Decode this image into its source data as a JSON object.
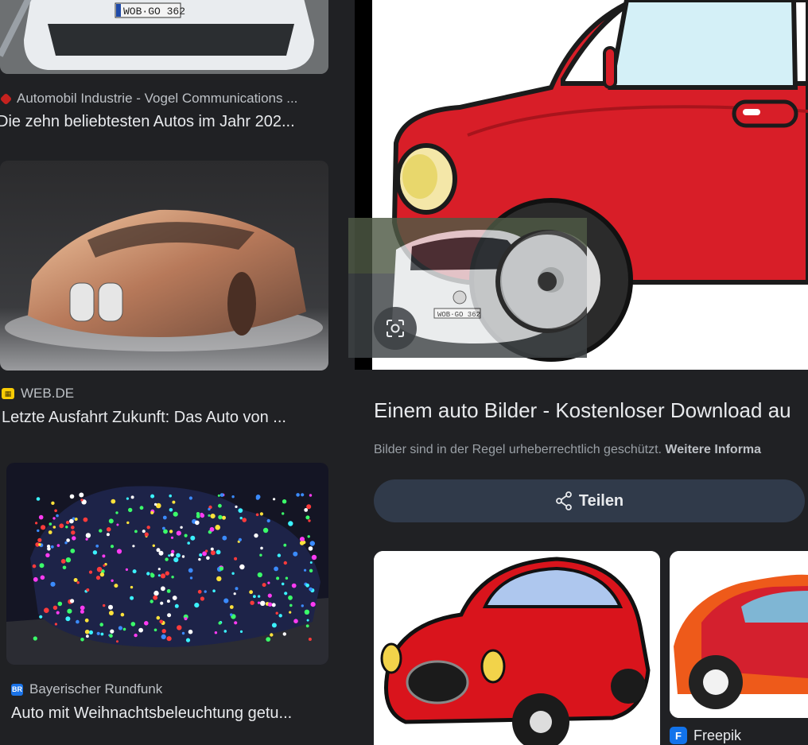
{
  "results": [
    {
      "source": "Automobil Industrie - Vogel Communications ...",
      "title": "Die zehn beliebtesten Autos im Jahr 202...",
      "plate": "WOB·GO 362"
    },
    {
      "source": "WEB.DE",
      "title": "Letzte Ausfahrt Zukunft: Das Auto von ..."
    },
    {
      "source": "Bayerischer Rundfunk",
      "title": "Auto mit Weihnachtsbeleuchtung getu...",
      "favicon_text": "BR"
    }
  ],
  "preview": {
    "title": "Einem auto Bilder - Kostenloser Download au",
    "notice": "Bilder sind in der Regel urheberrechtlich geschützt.",
    "notice_link": "Weitere Informa",
    "share_label": "Teilen",
    "overlay_plate": "WOB·GO 362",
    "related_source": "Freepik"
  },
  "colors": {
    "background": "#202124",
    "panel": "#202124",
    "share_button": "#303a4a",
    "car_red": "#d81e28"
  },
  "icons": [
    "lens-icon",
    "share-icon",
    "freepik-icon",
    "webde-icon",
    "br-icon",
    "vogel-icon"
  ]
}
